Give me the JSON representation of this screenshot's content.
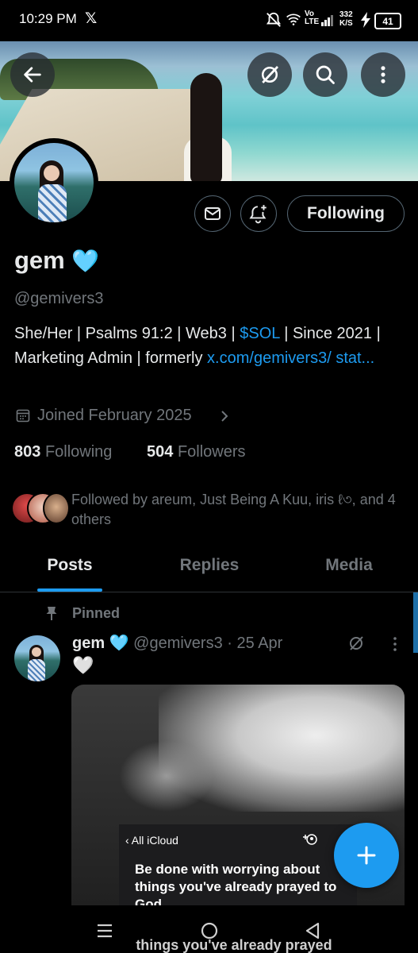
{
  "status_bar": {
    "time": "10:29 PM",
    "x_logo": "𝕏",
    "network_speed_value": "332",
    "network_speed_unit": "K/S",
    "volte": "Vo",
    "lte": "LTE",
    "battery": "41"
  },
  "header": {
    "back_icon": "back-arrow-icon",
    "grok_icon": "grok-icon",
    "search_icon": "search-icon",
    "more_icon": "more-vertical-icon"
  },
  "profile": {
    "display_name": "gem",
    "verified_emoji": "🩵",
    "handle": "@gemivers3",
    "bio_part1": "She/Her | Psalms 91:2 | Web3 | ",
    "bio_cashtag": "$SOL",
    "bio_part2": " | Since 2021 | Marketing Admin | formerly ",
    "bio_link": "x.com/gemivers3/ stat...",
    "joined": "Joined February 2025",
    "following_count": "803",
    "following_label": "Following",
    "followers_count": "504",
    "followers_label": "Followers",
    "followed_by": "Followed by areum, Just Being A Kuu, iris ℓ৩, and 4 others"
  },
  "actions": {
    "following_button": "Following"
  },
  "tabs": [
    {
      "label": "Posts",
      "active": true
    },
    {
      "label": "Replies",
      "active": false
    },
    {
      "label": "Media",
      "active": false
    }
  ],
  "pinned_post": {
    "pinned_label": "Pinned",
    "name": "gem",
    "verified_emoji": "🩵",
    "handle_date": "@gemivers3 · 25 Apr",
    "text": "🤍",
    "image_header": "All iCloud",
    "image_text": "Be done with worrying about things you've already prayed to God",
    "image_text_echo": "things you've already prayed"
  },
  "fab": {
    "icon": "plus-icon"
  },
  "nav_bar": {
    "menu_icon": "recent-apps-icon",
    "home_icon": "home-icon",
    "back_icon": "nav-back-icon"
  },
  "colors": {
    "accent": "#1d9bf0",
    "muted": "#71767b",
    "background": "#000000",
    "text": "#e7e9ea"
  }
}
